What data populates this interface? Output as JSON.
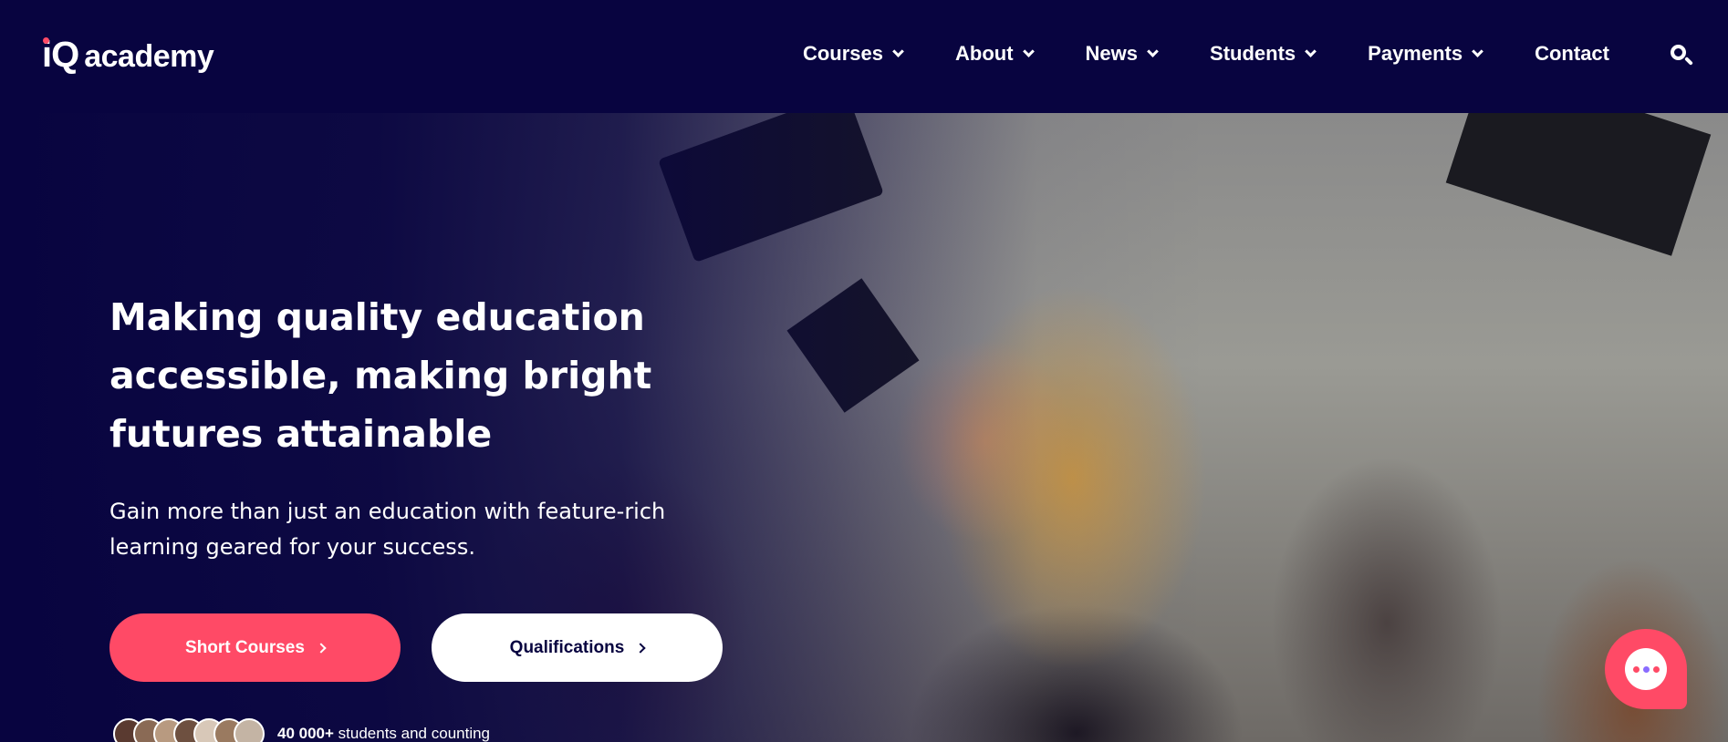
{
  "brand": {
    "logo_iq": "iQ",
    "logo_word": "academy"
  },
  "nav": {
    "items": [
      {
        "label": "Courses",
        "has_dropdown": true
      },
      {
        "label": "About",
        "has_dropdown": true
      },
      {
        "label": "News",
        "has_dropdown": true
      },
      {
        "label": "Students",
        "has_dropdown": true
      },
      {
        "label": "Payments",
        "has_dropdown": true
      },
      {
        "label": "Contact",
        "has_dropdown": false
      }
    ],
    "search_icon": "search-icon"
  },
  "hero": {
    "headline": "Making quality education accessible, making bright futures attainable",
    "subtext": "Gain more than just an education with feature-rich learning geared for your success.",
    "primary_button": "Short Courses",
    "secondary_button": "Qualifications",
    "students_count": "40 000+",
    "students_text": " students and counting"
  },
  "colors": {
    "navy": "#080440",
    "accent": "#ff4a66",
    "white": "#ffffff"
  },
  "chat": {
    "icon": "chat-bubble-icon"
  }
}
